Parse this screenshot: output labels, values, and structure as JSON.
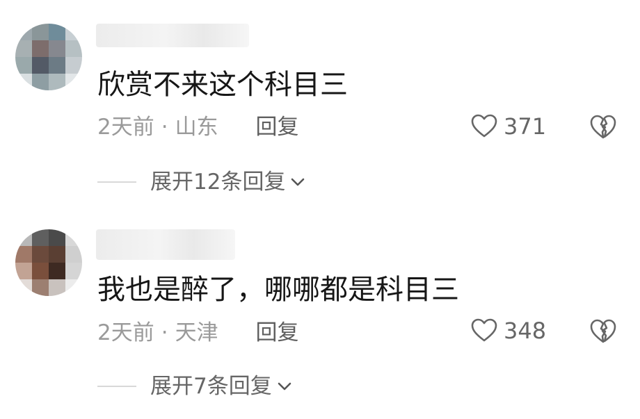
{
  "comments": [
    {
      "text": "欣赏不来这个科目三",
      "time": "2天前",
      "sep": "·",
      "location": "山东",
      "reply_label": "回复",
      "likes": "371",
      "expand_label": "展开12条回复"
    },
    {
      "text": "我也是醉了，哪哪都是科目三",
      "time": "2天前",
      "sep": "·",
      "location": "天津",
      "reply_label": "回复",
      "likes": "348",
      "expand_label": "展开7条回复"
    }
  ],
  "icons": {
    "like": "heart-outline-icon",
    "dislike": "broken-heart-icon",
    "expand": "chevron-down-icon"
  },
  "colors": {
    "text": "#161616",
    "meta": "#9a9a9a",
    "secondary": "#666666"
  }
}
